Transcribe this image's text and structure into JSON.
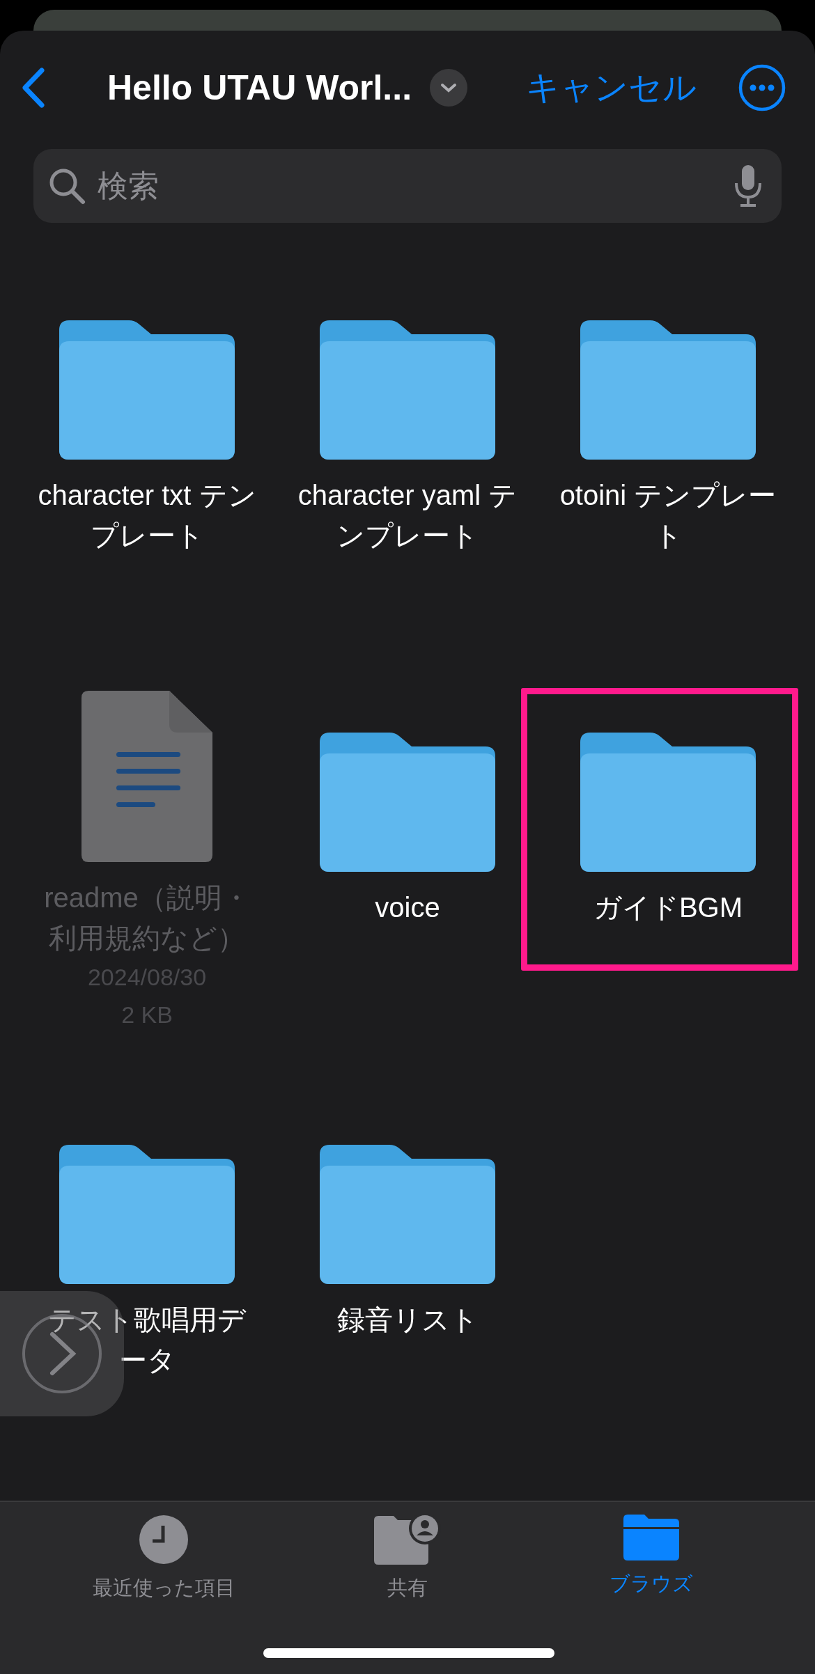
{
  "nav": {
    "title": "Hello UTAU Worl...",
    "cancel": "キャンセル"
  },
  "search": {
    "placeholder": "検索"
  },
  "items": [
    {
      "kind": "folder",
      "name": "character txt テンプレート",
      "disabled": false,
      "highlighted": false
    },
    {
      "kind": "folder",
      "name": "character yaml テンプレート",
      "disabled": false,
      "highlighted": false
    },
    {
      "kind": "folder",
      "name": "otoini テンプレート",
      "disabled": false,
      "highlighted": false
    },
    {
      "kind": "file",
      "name": "readme（説明・利用規約など）",
      "date": "2024/08/30",
      "size": "2 KB",
      "disabled": true,
      "highlighted": false
    },
    {
      "kind": "folder",
      "name": "voice",
      "disabled": false,
      "highlighted": false
    },
    {
      "kind": "folder",
      "name": "ガイドBGM",
      "disabled": false,
      "highlighted": true
    },
    {
      "kind": "folder",
      "name": "テスト歌唱用データ",
      "disabled": false,
      "highlighted": false
    },
    {
      "kind": "folder",
      "name": "録音リスト",
      "disabled": false,
      "highlighted": false
    }
  ],
  "tabs": [
    {
      "kind": "recents",
      "label": "最近使った項目",
      "selected": false
    },
    {
      "kind": "shared",
      "label": "共有",
      "selected": false
    },
    {
      "kind": "browse",
      "label": "ブラウズ",
      "selected": true
    }
  ]
}
